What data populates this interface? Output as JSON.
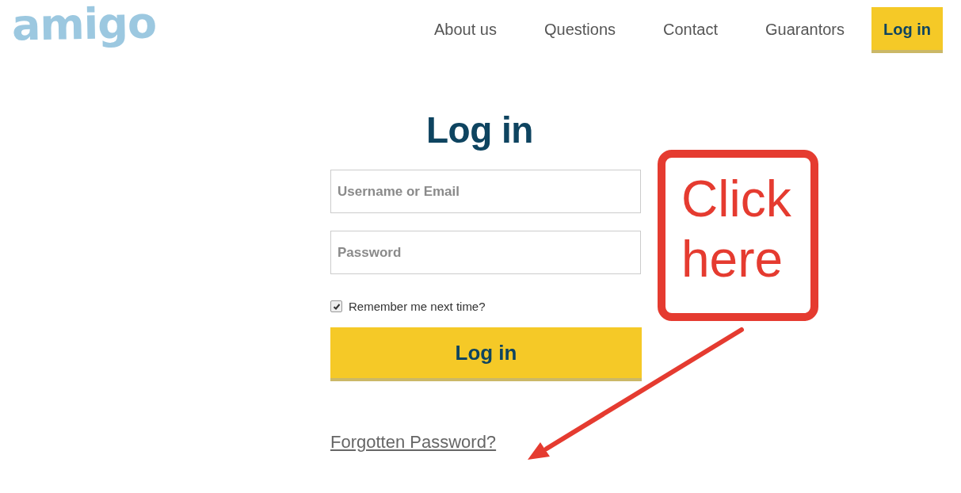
{
  "header": {
    "logo": "amigo",
    "nav": [
      {
        "label": "About us",
        "selected": false
      },
      {
        "label": "Questions",
        "selected": false
      },
      {
        "label": "Contact",
        "selected": false
      },
      {
        "label": "Guarantors",
        "selected": false
      },
      {
        "label": "Log in",
        "selected": true
      }
    ]
  },
  "form": {
    "title": "Log in",
    "fields": [
      {
        "placeholder": "Username or Email"
      },
      {
        "placeholder": "Password"
      }
    ],
    "remember": {
      "label": "Remember me next time?",
      "checked": true
    },
    "submit": "Log in",
    "forgot_link": "Forgotten Password?"
  },
  "annotation": {
    "lines": [
      "Click",
      "here"
    ]
  }
}
